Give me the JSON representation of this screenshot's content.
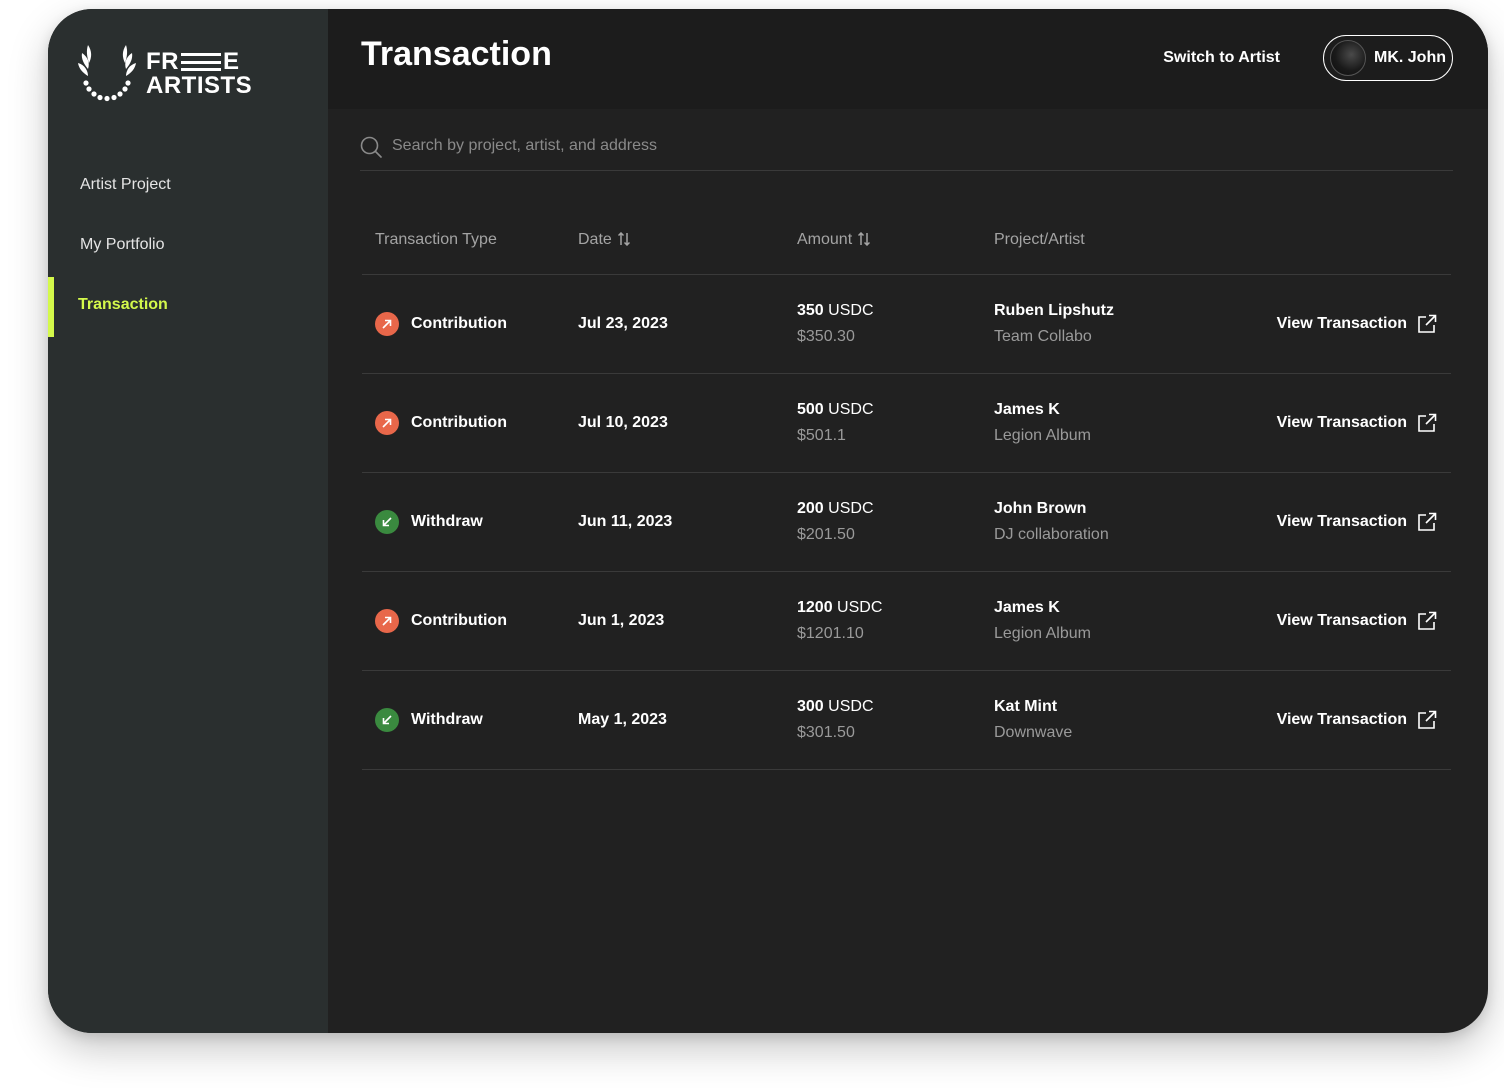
{
  "brand": {
    "logo_line1_left": "FR",
    "logo_line1_right": "E",
    "logo_line2": "ARTISTS",
    "accent_color": "#d4f94b"
  },
  "sidebar": {
    "items": [
      {
        "label": "Artist Project",
        "active": false
      },
      {
        "label": "My Portfolio",
        "active": false
      },
      {
        "label": "Transaction",
        "active": true
      }
    ]
  },
  "header": {
    "title": "Transaction",
    "switch_label": "Switch to Artist",
    "user_name": "MK. John"
  },
  "search": {
    "placeholder": "Search by project, artist, and address",
    "icon": "search-icon"
  },
  "table": {
    "columns": {
      "type": "Transaction Type",
      "date": "Date",
      "amount": "Amount",
      "project": "Project/Artist"
    },
    "rows": [
      {
        "type": "Contribution",
        "kind": "contribution",
        "date": "Jul 23, 2023",
        "amount_value": "350",
        "amount_unit": "USDC",
        "usd": "$350.30",
        "artist": "Ruben Lipshutz",
        "project": "Team Collabo",
        "action": "View Transaction"
      },
      {
        "type": "Contribution",
        "kind": "contribution",
        "date": "Jul 10, 2023",
        "amount_value": "500",
        "amount_unit": "USDC",
        "usd": "$501.1",
        "artist": "James K",
        "project": "Legion Album",
        "action": "View Transaction"
      },
      {
        "type": "Withdraw",
        "kind": "withdraw",
        "date": "Jun 11, 2023",
        "amount_value": "200",
        "amount_unit": "USDC",
        "usd": "$201.50",
        "artist": "John Brown",
        "project": "DJ collaboration",
        "action": "View Transaction"
      },
      {
        "type": "Contribution",
        "kind": "contribution",
        "date": "Jun 1, 2023",
        "amount_value": "1200",
        "amount_unit": "USDC",
        "usd": "$1201.10",
        "artist": "James K",
        "project": "Legion Album",
        "action": "View Transaction"
      },
      {
        "type": "Withdraw",
        "kind": "withdraw",
        "date": "May 1, 2023",
        "amount_value": "300",
        "amount_unit": "USDC",
        "usd": "$301.50",
        "artist": "Kat Mint",
        "project": "Downwave",
        "action": "View Transaction"
      }
    ]
  },
  "colors": {
    "contribution": "#e8674a",
    "withdraw": "#3a8a3f"
  }
}
